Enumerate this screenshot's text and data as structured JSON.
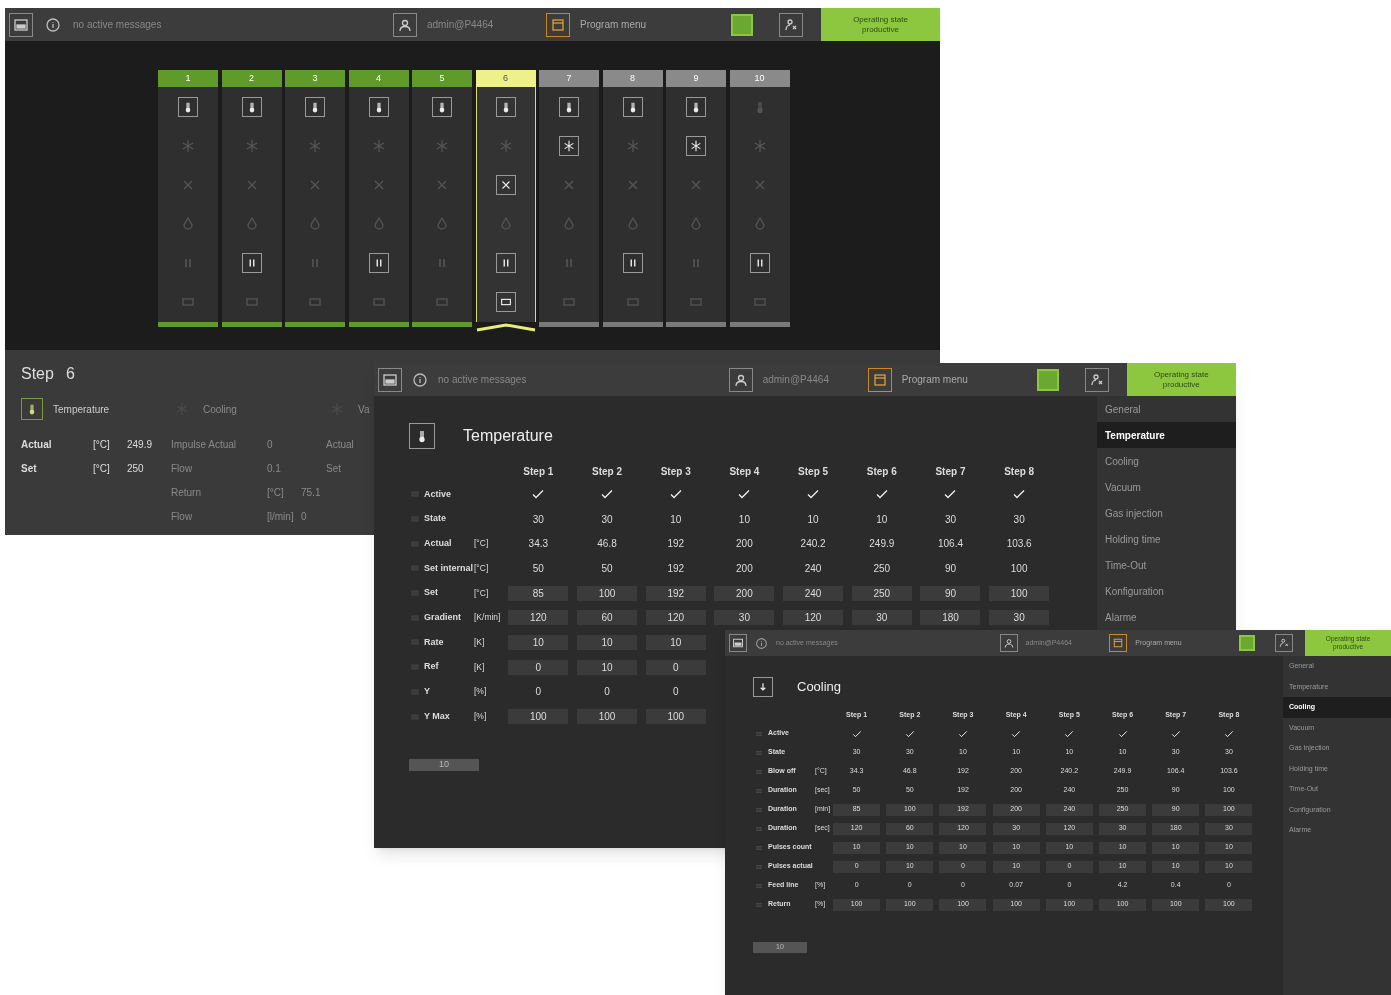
{
  "overview_window": {
    "header": {
      "messages": "no active messages",
      "user": "admin@P4464",
      "program": "Program menu",
      "state": "Operating state productive"
    },
    "steps": [
      {
        "label": "1",
        "completed": true,
        "selected": false,
        "modules": [
          true,
          false,
          false,
          false,
          false,
          false
        ]
      },
      {
        "label": "2",
        "completed": true,
        "selected": false,
        "modules": [
          true,
          false,
          false,
          false,
          true,
          false
        ]
      },
      {
        "label": "3",
        "completed": true,
        "selected": false,
        "modules": [
          true,
          false,
          false,
          false,
          false,
          false
        ]
      },
      {
        "label": "4",
        "completed": true,
        "selected": false,
        "modules": [
          true,
          false,
          false,
          false,
          true,
          false
        ]
      },
      {
        "label": "5",
        "completed": true,
        "selected": false,
        "modules": [
          true,
          false,
          false,
          false,
          false,
          false
        ]
      },
      {
        "label": "6",
        "completed": false,
        "selected": true,
        "modules": [
          true,
          false,
          true,
          false,
          true,
          true
        ]
      },
      {
        "label": "7",
        "completed": false,
        "selected": false,
        "modules": [
          true,
          true,
          false,
          false,
          false,
          false
        ]
      },
      {
        "label": "8",
        "completed": false,
        "selected": false,
        "modules": [
          true,
          false,
          false,
          false,
          true,
          false
        ]
      },
      {
        "label": "9",
        "completed": false,
        "selected": false,
        "modules": [
          true,
          true,
          false,
          false,
          false,
          false
        ]
      },
      {
        "label": "10",
        "completed": false,
        "selected": false,
        "modules": [
          false,
          false,
          false,
          false,
          true,
          false
        ]
      }
    ],
    "step_detail": {
      "title": "Step",
      "number": "6",
      "groups": [
        {
          "title": "Temperature",
          "active": true,
          "rows": [
            {
              "label": "Actual",
              "unit": "[°C]",
              "value": "249.9"
            },
            {
              "label": "Set",
              "unit": "[°C]",
              "value": "250"
            }
          ]
        },
        {
          "title": "Cooling",
          "active": false,
          "rows": [
            {
              "label": "Impulse Actual",
              "value": "0"
            },
            {
              "label": "Flow",
              "value": "0.1"
            },
            {
              "label": "Return",
              "unit": "[°C]",
              "value": "75.1"
            },
            {
              "label": "Flow",
              "unit": "[l/min]",
              "value": "0"
            }
          ]
        },
        {
          "title": "Va",
          "active": false,
          "rows": [
            {
              "label": "Actual"
            },
            {
              "label": "Set"
            }
          ]
        }
      ]
    }
  },
  "temperature_window": {
    "header": {
      "messages": "no active messages",
      "user": "admin@P4464",
      "program": "Program menu",
      "state": "Operating state productive"
    },
    "title": "Temperature",
    "table": {
      "columns": [
        "Step 1",
        "Step 2",
        "Step 3",
        "Step 4",
        "Step 5",
        "Step 6",
        "Step 7",
        "Step 8"
      ],
      "rows": [
        {
          "label": "Active",
          "kind": "check",
          "checked": [
            true,
            true,
            true,
            true,
            true,
            true,
            true,
            true
          ]
        },
        {
          "label": "State",
          "kind": "text",
          "values": [
            "30",
            "30",
            "10",
            "10",
            "10",
            "10",
            "30",
            "30"
          ]
        },
        {
          "label": "Actual",
          "unit": "[°C]",
          "kind": "text",
          "values": [
            "34.3",
            "46.8",
            "192",
            "200",
            "240.2",
            "249.9",
            "106.4",
            "103.6"
          ]
        },
        {
          "label": "Set internal",
          "unit": "[°C]",
          "kind": "text",
          "values": [
            "50",
            "50",
            "192",
            "200",
            "240",
            "250",
            "90",
            "100"
          ]
        },
        {
          "label": "Set",
          "unit": "[°C]",
          "kind": "input",
          "values": [
            "85",
            "100",
            "192",
            "200",
            "240",
            "250",
            "90",
            "100"
          ]
        },
        {
          "label": "Gradient",
          "unit": "[K/min]",
          "kind": "input",
          "values": [
            "120",
            "60",
            "120",
            "30",
            "120",
            "30",
            "180",
            "30"
          ]
        },
        {
          "label": "Rate",
          "unit": "[K]",
          "kind": "input",
          "values": [
            "10",
            "10",
            "10"
          ]
        },
        {
          "label": "Ref",
          "unit": "[K]",
          "kind": "input",
          "values": [
            "0",
            "10",
            "0"
          ]
        },
        {
          "label": "Y",
          "unit": "[%]",
          "kind": "text",
          "values": [
            "0",
            "0",
            "0"
          ]
        },
        {
          "label": "Y Max",
          "unit": "[%]",
          "kind": "input",
          "values": [
            "100",
            "100",
            "100"
          ]
        }
      ]
    },
    "step_count": "10",
    "sidebar": [
      {
        "label": "General",
        "selected": false
      },
      {
        "label": "Temperature",
        "selected": true
      },
      {
        "label": "Cooling",
        "selected": false
      },
      {
        "label": "Vacuum",
        "selected": false
      },
      {
        "label": "Gas injection",
        "selected": false
      },
      {
        "label": "Holding time",
        "selected": false
      },
      {
        "label": "Time-Out",
        "selected": false
      },
      {
        "label": "Konfiguration",
        "selected": false
      },
      {
        "label": "Alarme",
        "selected": false
      }
    ]
  },
  "cooling_window": {
    "header": {
      "messages": "no active messages",
      "user": "admin@P4464",
      "program": "Program menu",
      "state": "Operating state productive"
    },
    "title": "Cooling",
    "table": {
      "columns": [
        "Step 1",
        "Step 2",
        "Step 3",
        "Step 4",
        "Step 5",
        "Step 6",
        "Step 7",
        "Step 8"
      ],
      "rows": [
        {
          "label": "Active",
          "kind": "check",
          "checked": [
            true,
            true,
            true,
            true,
            true,
            true,
            true,
            true
          ]
        },
        {
          "label": "State",
          "kind": "text",
          "values": [
            "30",
            "30",
            "10",
            "10",
            "10",
            "10",
            "30",
            "30"
          ]
        },
        {
          "label": "Blow off",
          "unit": "[°C]",
          "kind": "text",
          "values": [
            "34.3",
            "46.8",
            "192",
            "200",
            "240.2",
            "249.9",
            "106.4",
            "103.6"
          ]
        },
        {
          "label": "Duration",
          "unit": "[sec]",
          "kind": "text",
          "values": [
            "50",
            "50",
            "192",
            "200",
            "240",
            "250",
            "90",
            "100"
          ]
        },
        {
          "label": "Duration",
          "unit": "[min]",
          "kind": "input",
          "values": [
            "85",
            "100",
            "192",
            "200",
            "240",
            "250",
            "90",
            "100"
          ]
        },
        {
          "label": "Duration",
          "unit": "[sec]",
          "kind": "input",
          "values": [
            "120",
            "60",
            "120",
            "30",
            "120",
            "30",
            "180",
            "30"
          ]
        },
        {
          "label": "Pulses count",
          "kind": "input",
          "values": [
            "10",
            "10",
            "10",
            "10",
            "10",
            "10",
            "10",
            "10"
          ]
        },
        {
          "label": "Pulses actual",
          "kind": "input",
          "values": [
            "0",
            "10",
            "0",
            "10",
            "0",
            "10",
            "10",
            "10"
          ]
        },
        {
          "label": "Feed line",
          "unit": "[%]",
          "kind": "text",
          "values": [
            "0",
            "0",
            "0",
            "0.07",
            "0",
            "4.2",
            "0.4",
            "0"
          ]
        },
        {
          "label": "Return",
          "unit": "[%]",
          "kind": "input",
          "values": [
            "100",
            "100",
            "100",
            "100",
            "100",
            "100",
            "100",
            "100"
          ]
        }
      ]
    },
    "step_count": "10",
    "sidebar": [
      {
        "label": "General",
        "selected": false
      },
      {
        "label": "Temperature",
        "selected": false
      },
      {
        "label": "Cooling",
        "selected": true
      },
      {
        "label": "Vacuum",
        "selected": false
      },
      {
        "label": "Gas injection",
        "selected": false
      },
      {
        "label": "Holding time",
        "selected": false
      },
      {
        "label": "Time-Out",
        "selected": false
      },
      {
        "label": "Configuration",
        "selected": false
      },
      {
        "label": "Alarme",
        "selected": false
      }
    ]
  }
}
